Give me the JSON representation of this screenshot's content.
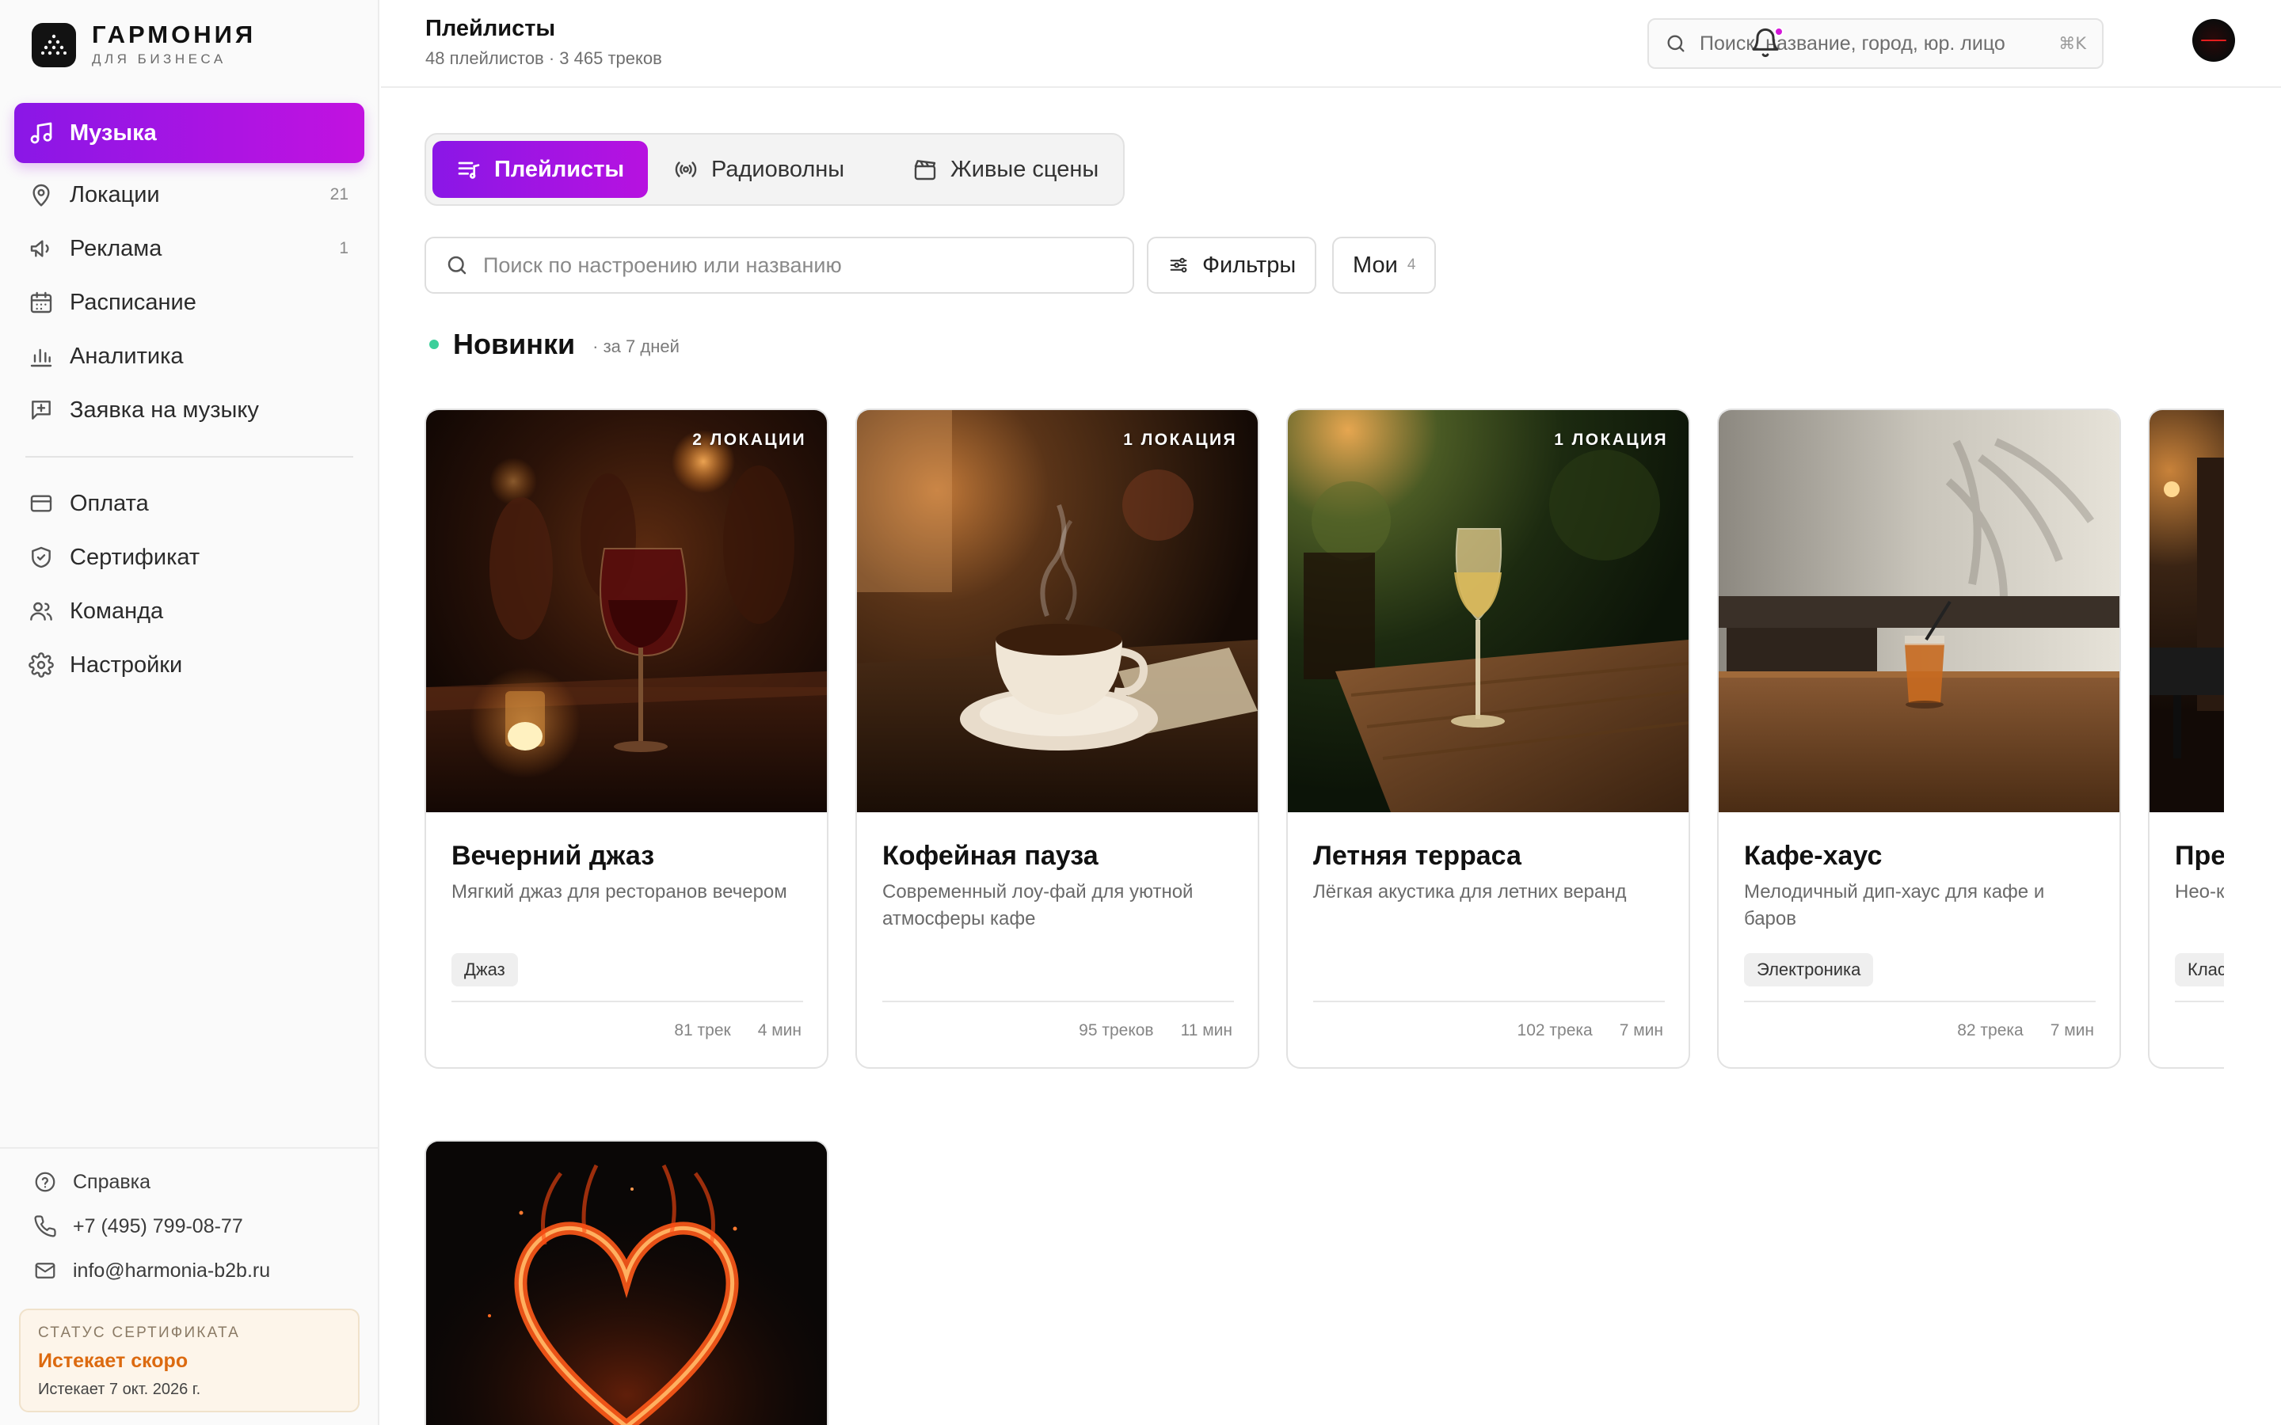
{
  "brand": {
    "name": "ГАРМОНИЯ",
    "sub": "ДЛЯ БИЗНЕСА"
  },
  "sidebar": {
    "items": [
      {
        "label": "Музыка",
        "icon": "music-note-icon",
        "active": true
      },
      {
        "label": "Локации",
        "icon": "location-pin-icon",
        "count": "21"
      },
      {
        "label": "Реклама",
        "icon": "megaphone-icon",
        "count": "1"
      },
      {
        "label": "Расписание",
        "icon": "calendar-icon"
      },
      {
        "label": "Аналитика",
        "icon": "bar-chart-icon"
      },
      {
        "label": "Заявка на музыку",
        "icon": "request-icon"
      }
    ],
    "items2": [
      {
        "label": "Оплата",
        "icon": "credit-card-icon"
      },
      {
        "label": "Сертификат",
        "icon": "shield-check-icon"
      },
      {
        "label": "Команда",
        "icon": "users-icon"
      },
      {
        "label": "Настройки",
        "icon": "gear-icon"
      }
    ],
    "footer": {
      "help": "Справка",
      "phone": "+7 (495) 799-08-77",
      "email": "info@harmonia-b2b.ru"
    },
    "certificate": {
      "title": "СТАТУС СЕРТИФИКАТА",
      "status": "Истекает скоро",
      "date": "Истекает 7 окт. 2026 г.",
      "status_color": "#dc6a10"
    }
  },
  "header": {
    "title": "Плейлисты",
    "subtitle": "48 плейлистов · 3 465 треков",
    "search_placeholder": "Поиск: название, город, юр. лицо",
    "shortcut": "⌘K"
  },
  "tabs": [
    {
      "label": "Плейлисты",
      "icon": "playlist-icon",
      "active": true
    },
    {
      "label": "Радиоволны",
      "icon": "radio-waves-icon"
    },
    {
      "label": "Живые сцены",
      "icon": "clapperboard-icon"
    }
  ],
  "filters": {
    "search_placeholder": "Поиск по настроению или названию",
    "filters_label": "Фильтры",
    "mine_label": "Мои",
    "mine_count": "4"
  },
  "section": {
    "title": "Новинки",
    "subtitle": "· за 7 дней"
  },
  "cards": [
    {
      "title": "Вечерний джаз",
      "desc": "Мягкий джаз для ресторанов вечером",
      "tag": "Джаз",
      "badge": "2 ЛОКАЦИИ",
      "tracks": "81 трек",
      "duration": "4 мин"
    },
    {
      "title": "Кофейная пауза",
      "desc": "Современный лоу-фай для уютной атмосферы кафе",
      "tag": "",
      "badge": "1 ЛОКАЦИЯ",
      "tracks": "95 треков",
      "duration": "11 мин"
    },
    {
      "title": "Летняя терраса",
      "desc": "Лёгкая акустика для летних веранд",
      "tag": "",
      "badge": "1 ЛОКАЦИЯ",
      "tracks": "102 трека",
      "duration": "7 мин"
    },
    {
      "title": "Кафе-хаус",
      "desc": "Мелодичный дип-хаус для кафе и баров",
      "tag": "Электроника",
      "badge": "",
      "tracks": "82 трека",
      "duration": "7 мин"
    },
    {
      "title": "Пре",
      "desc": "Нео-к преми",
      "tag": "Клас",
      "badge": "",
      "tracks": "",
      "duration": ""
    }
  ],
  "colors": {
    "accent": "#8a17e6",
    "accent2": "#c212e0",
    "new_dot": "#3ccf9a",
    "notification": "#d417d9"
  }
}
